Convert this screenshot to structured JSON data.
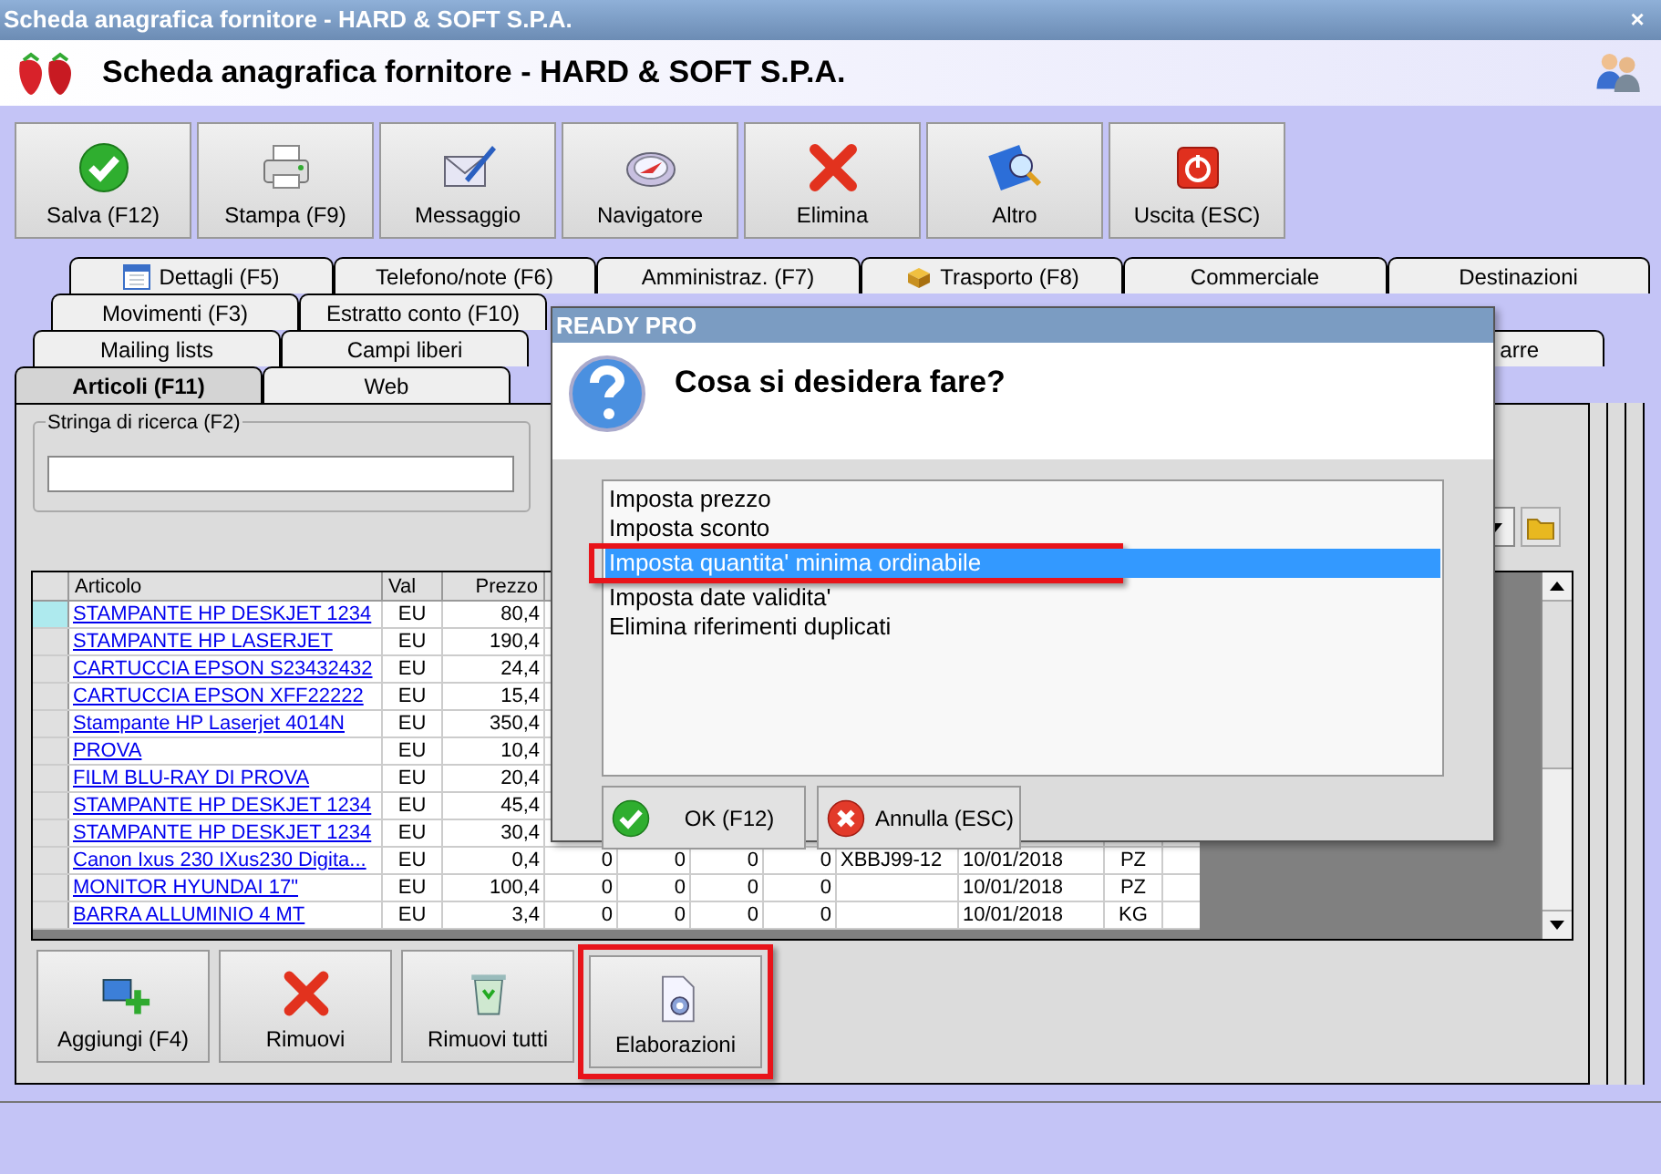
{
  "window": {
    "title": "Scheda anagrafica fornitore - HARD & SOFT S.P.A.",
    "close": "×"
  },
  "header": {
    "title": "Scheda anagrafica fornitore - HARD & SOFT S.P.A."
  },
  "toolbar": [
    {
      "label": "Salva (F12)",
      "kind": "check"
    },
    {
      "label": "Stampa (F9)",
      "kind": "printer"
    },
    {
      "label": "Messaggio",
      "kind": "letter"
    },
    {
      "label": "Navigatore",
      "kind": "compass"
    },
    {
      "label": "Elimina",
      "kind": "cross"
    },
    {
      "label": "Altro",
      "kind": "magnifier"
    },
    {
      "label": "Uscita (ESC)",
      "kind": "power"
    }
  ],
  "tab_rows": [
    [
      {
        "label": "Dettagli (F5)",
        "kind": "calendar",
        "selected": false
      },
      {
        "label": "Telefono/note (F6)",
        "selected": false
      },
      {
        "label": "Amministraz. (F7)",
        "selected": false
      },
      {
        "label": "Trasporto (F8)",
        "kind": "box",
        "selected": false
      },
      {
        "label": "Commerciale",
        "selected": false
      },
      {
        "label": "Destinazioni",
        "selected": false
      }
    ],
    [
      {
        "label": "Movimenti (F3)",
        "selected": false
      },
      {
        "label": "Estratto conto (F10)",
        "selected": false
      }
    ],
    [
      {
        "label": "Mailing lists",
        "selected": false
      },
      {
        "label": "Campi liberi",
        "selected": false
      },
      {
        "label": "arre",
        "selected": false,
        "kind": "right"
      }
    ],
    [
      {
        "label": "Articoli (F11)",
        "selected": true
      },
      {
        "label": "Web",
        "selected": false
      }
    ]
  ],
  "search": {
    "label": "Stringa di ricerca (F2)"
  },
  "table": {
    "columns": [
      "Articolo",
      "Val",
      "Prezzo"
    ],
    "rows": [
      {
        "selected": true,
        "cells": [
          "STAMPANTE HP DESKJET 1234",
          "EU",
          "80,4"
        ]
      },
      {
        "selected": false,
        "cells": [
          "STAMPANTE HP LASERJET",
          "EU",
          "190,4"
        ]
      },
      {
        "selected": false,
        "cells": [
          "CARTUCCIA EPSON S23432432",
          "EU",
          "24,4"
        ]
      },
      {
        "selected": false,
        "cells": [
          "CARTUCCIA EPSON XFF22222",
          "EU",
          "15,4"
        ]
      },
      {
        "selected": false,
        "cells": [
          "Stampante HP Laserjet 4014N",
          "EU",
          "350,4"
        ]
      },
      {
        "selected": false,
        "cells": [
          "PROVA",
          "EU",
          "10,4"
        ]
      },
      {
        "selected": false,
        "cells": [
          "FILM BLU-RAY DI PROVA",
          "EU",
          "20,4"
        ]
      },
      {
        "selected": false,
        "cells": [
          "STAMPANTE HP DESKJET 1234",
          "EU",
          "45,4"
        ]
      },
      {
        "selected": false,
        "cells": [
          "STAMPANTE HP DESKJET 1234",
          "EU",
          "30,4"
        ]
      },
      {
        "selected": false,
        "cells": [
          "Canon Ixus 230 IXus230 Digita...",
          "EU",
          "0,4",
          "0",
          "0",
          "0",
          "0",
          "XBBJ99-12",
          "10/01/2018",
          "PZ"
        ]
      },
      {
        "selected": false,
        "cells": [
          "MONITOR HYUNDAI 17\"",
          "EU",
          "100,4",
          "0",
          "0",
          "0",
          "0",
          "",
          "10/01/2018",
          "PZ"
        ]
      },
      {
        "selected": false,
        "cells": [
          "BARRA ALLUMINIO 4 MT",
          "EU",
          "3,4",
          "0",
          "0",
          "0",
          "0",
          "",
          "10/01/2018",
          "KG"
        ]
      }
    ]
  },
  "bottom_buttons": [
    {
      "label": "Aggiungi (F4)",
      "kind": "add",
      "highlighted": false
    },
    {
      "label": "Rimuovi",
      "kind": "cross",
      "highlighted": false
    },
    {
      "label": "Rimuovi tutti",
      "kind": "bin",
      "highlighted": false
    },
    {
      "label": "Elaborazioni",
      "kind": "gear",
      "highlighted": true
    }
  ],
  "dialog": {
    "title": "READY PRO",
    "question": "Cosa si desidera fare?",
    "options": [
      {
        "label": "Imposta prezzo",
        "selected": false,
        "highlighted": false
      },
      {
        "label": "Imposta sconto",
        "selected": false,
        "highlighted": false
      },
      {
        "label": "Imposta quantita' minima ordinabile",
        "selected": true,
        "highlighted": true
      },
      {
        "label": "Imposta date validita'",
        "selected": false,
        "highlighted": false
      },
      {
        "label": "Elimina riferimenti duplicati",
        "selected": false,
        "highlighted": false
      }
    ],
    "buttons": [
      {
        "label": "OK (F12)",
        "kind": "check"
      },
      {
        "label": "Annulla (ESC)",
        "kind": "cancel"
      }
    ]
  }
}
